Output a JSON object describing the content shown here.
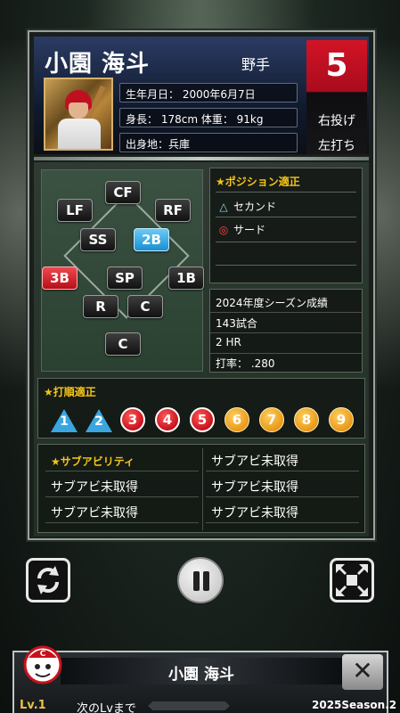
{
  "player": {
    "name": "小園 海斗",
    "position": "野手",
    "number": "5",
    "throws": "右投げ",
    "bats": "左打ち",
    "birthdate": "生年月日： 2000年6月7日",
    "physique": "身長： 178cm 体重： 91kg",
    "hometown": "出身地：兵庫"
  },
  "field_positions": [
    "CF",
    "LF",
    "RF",
    "SS",
    "2B",
    "3B",
    "SP",
    "1B",
    "R",
    "C",
    "C"
  ],
  "position_aptitude": {
    "title": "★ポジション適正",
    "items": [
      {
        "mark": "△",
        "label": "セカンド",
        "color": "#9fd8ff"
      },
      {
        "mark": "◎",
        "label": "サード",
        "color": "#ff4a4a"
      }
    ]
  },
  "season_stats": {
    "title": "2024年度シーズン成績",
    "games": "143試合",
    "hr": "2 HR",
    "avg": "打率： .280"
  },
  "batting_order": {
    "title": "★打順適正",
    "orders": [
      {
        "num": "1",
        "style": "tri"
      },
      {
        "num": "2",
        "style": "tri"
      },
      {
        "num": "3",
        "style": "red"
      },
      {
        "num": "4",
        "style": "red"
      },
      {
        "num": "5",
        "style": "red"
      },
      {
        "num": "6",
        "style": "orange"
      },
      {
        "num": "7",
        "style": "orange"
      },
      {
        "num": "8",
        "style": "orange"
      },
      {
        "num": "9",
        "style": "orange"
      }
    ]
  },
  "sub_ability": {
    "title": "★サブアビリティ",
    "cells": [
      "サブアビ未取得",
      "サブアビ未取得",
      "サブアビ未取得",
      "サブアビ未取得",
      "サブアビ未取得"
    ]
  },
  "controls": {
    "refresh_icon": "refresh-icon",
    "pause_icon": "pause-icon",
    "shrink_icon": "shrink-icon"
  },
  "bottom": {
    "name": "小園 海斗",
    "close": "✕",
    "level": "Lv.1",
    "next_level": "次のLvまで",
    "season": "2025Season.2"
  },
  "colors": {
    "team_red": "#c7121c",
    "highlight_blue": "#1b8fd0",
    "gold": "#f5c518"
  }
}
